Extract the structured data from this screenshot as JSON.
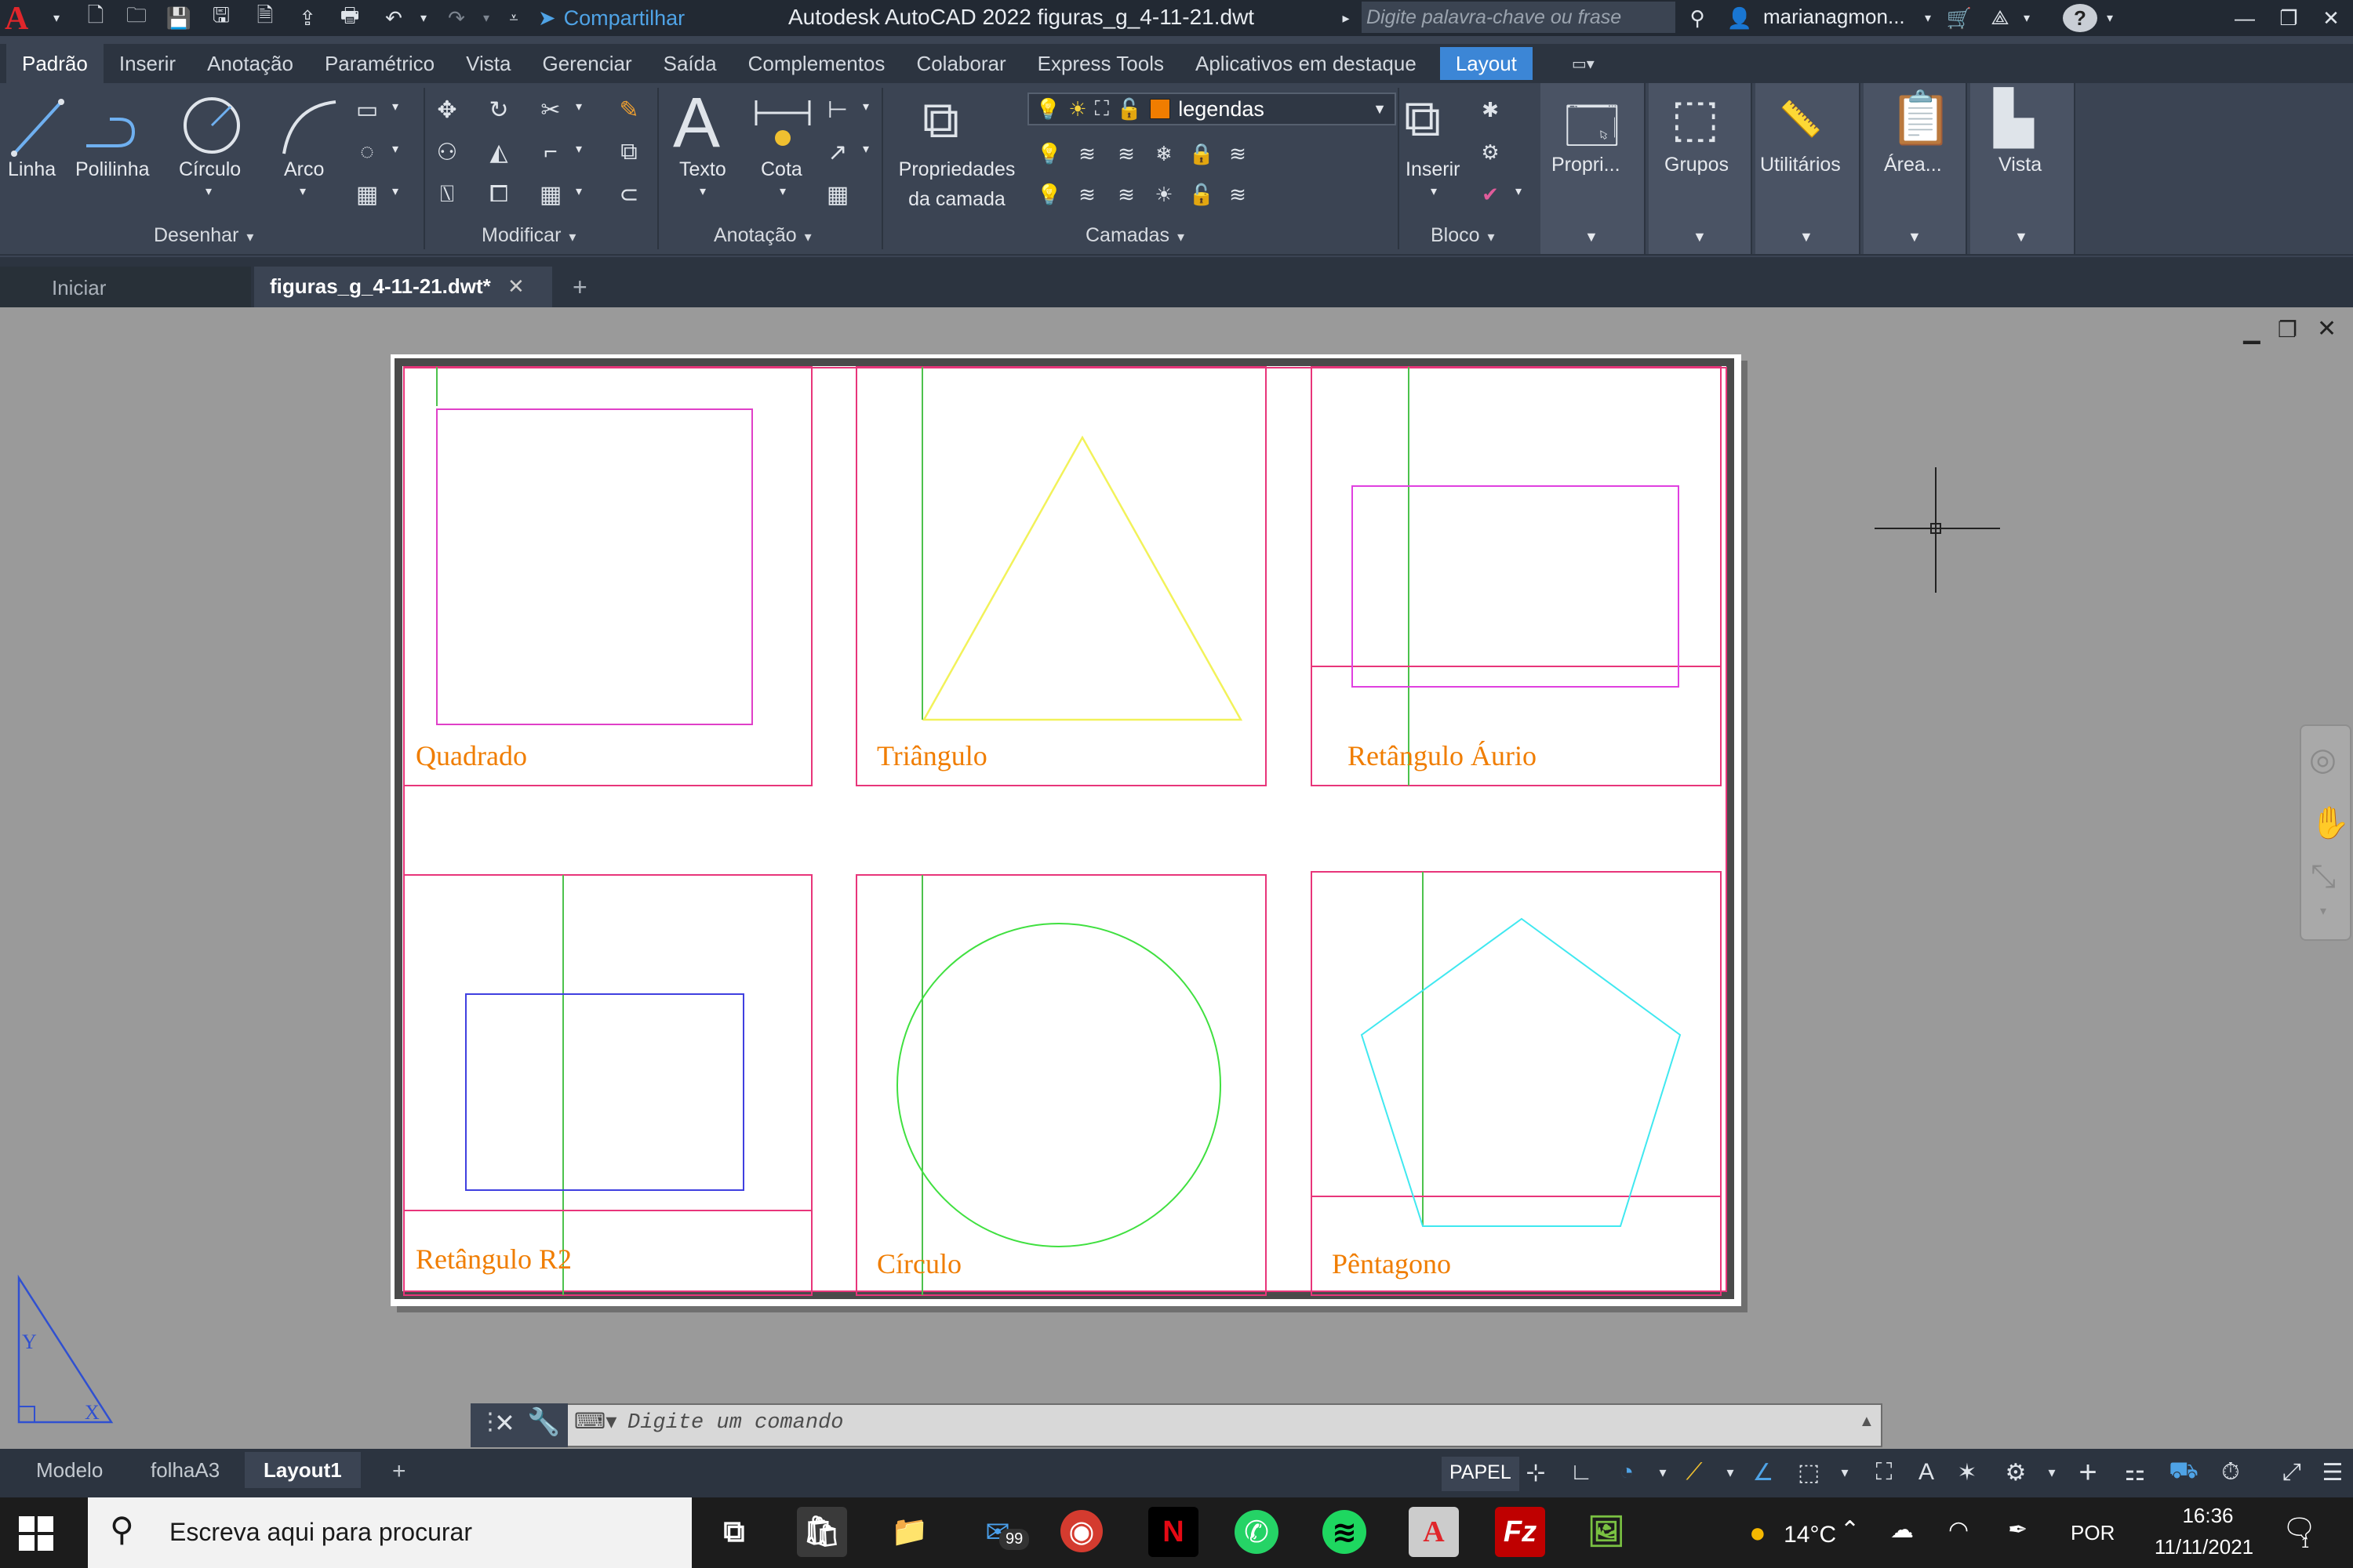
{
  "window": {
    "title": "Autodesk AutoCAD 2022    figuras_g_4-11-21.dwt",
    "share_label": "Compartilhar",
    "search_placeholder": "Digite palavra-chave ou frase",
    "user": "marianagmon...",
    "help_label": "?"
  },
  "ribbon_tabs": [
    {
      "label": "Padrão",
      "active": true
    },
    {
      "label": "Inserir"
    },
    {
      "label": "Anotação"
    },
    {
      "label": "Paramétrico"
    },
    {
      "label": "Vista"
    },
    {
      "label": "Gerenciar"
    },
    {
      "label": "Saída"
    },
    {
      "label": "Complementos"
    },
    {
      "label": "Colaborar"
    },
    {
      "label": "Express Tools"
    },
    {
      "label": "Aplicativos em destaque"
    },
    {
      "label": "Layout"
    }
  ],
  "ribbon": {
    "draw": {
      "title": "Desenhar",
      "line": "Linha",
      "polyline": "Polilinha",
      "circle": "Círculo",
      "arc": "Arco"
    },
    "modify": {
      "title": "Modificar"
    },
    "annotation": {
      "title": "Anotação",
      "text": "Texto",
      "dimension": "Cota",
      "text_glyph": "A"
    },
    "layers": {
      "title": "Camadas",
      "properties_line1": "Propriedades",
      "properties_line2": "da camada",
      "current_layer": "legendas",
      "layer_color": "#f07d00"
    },
    "block": {
      "title": "Bloco",
      "insert": "Inserir"
    },
    "properties": "Propri...",
    "groups": "Grupos",
    "utilities": "Utilitários",
    "clipboard": "Área...",
    "view": "Vista"
  },
  "doc_tabs": {
    "start": "Iniciar",
    "current": "figuras_g_4-11-21.dwt*",
    "close": "✕",
    "new": "+"
  },
  "drawing": {
    "labels": {
      "square": "Quadrado",
      "triangle": "Triângulo",
      "golden_rect": "Retângulo Áurio",
      "root2_rect": "Retângulo R2",
      "circle": "Círculo",
      "pentagon": "Pêntagono"
    },
    "colors": {
      "frame": "#e8357a",
      "guide": "#4cc24c",
      "square": "#e040c8",
      "triangle": "#f2f25a",
      "golden": "#e040e0",
      "root2": "#4040e0",
      "circle": "#40e040",
      "pentagon": "#40e8f0",
      "label": "#f07d00"
    }
  },
  "command_line": {
    "placeholder": "Digite um comando"
  },
  "layout_tabs": [
    {
      "label": "Modelo"
    },
    {
      "label": "folhaA3"
    },
    {
      "label": "Layout1",
      "active": true
    },
    {
      "label": "+"
    }
  ],
  "status_bar": {
    "space": "PAPEL"
  },
  "taskbar": {
    "search_placeholder": "Escreva aqui para procurar",
    "mail_badge": "99",
    "temperature": "14°C",
    "language": "POR",
    "time": "16:36",
    "date": "11/11/2021",
    "notification_count": "1"
  }
}
